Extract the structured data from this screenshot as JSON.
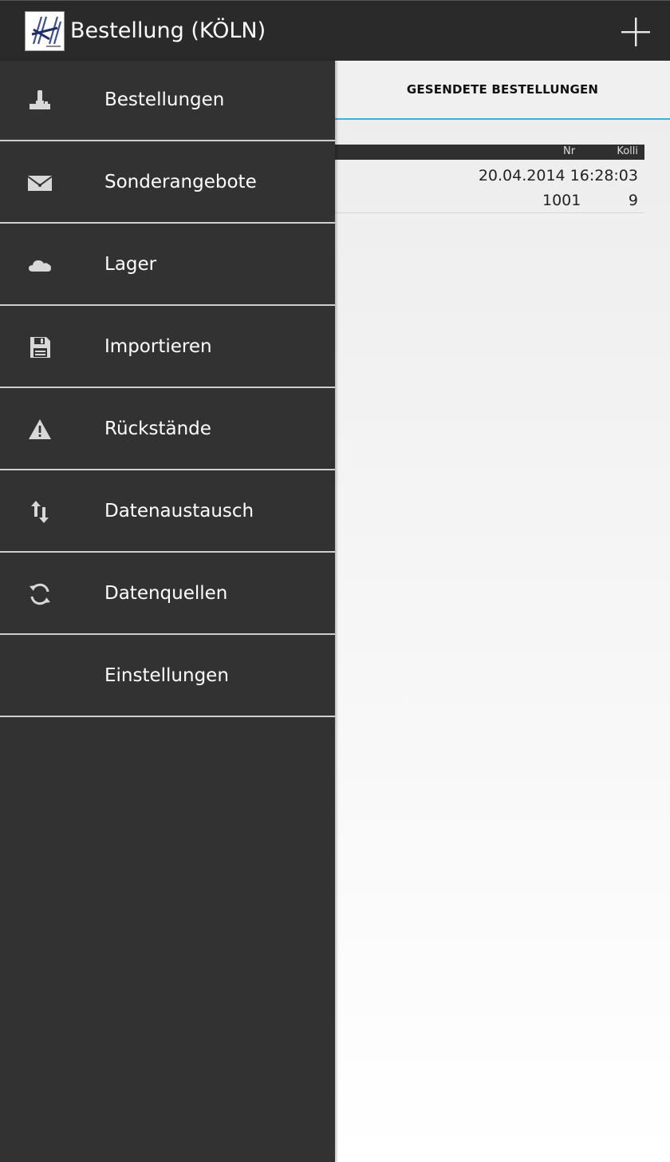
{
  "actionbar": {
    "title": "Bestellung (KÖLN)",
    "logo_icon": "company-logo",
    "add_icon": "plus-icon"
  },
  "tabs": [
    {
      "label": "GESENDETE BESTELLUNGEN",
      "active": true
    }
  ],
  "orders": {
    "columns": {
      "nr": "Nr",
      "kolli": "Kolli"
    },
    "rows": [
      {
        "date": "20.04.2014 16:28:03",
        "nr": "1001",
        "kolli": "9"
      }
    ]
  },
  "drawer": {
    "items": [
      {
        "label": "Bestellungen",
        "icon": "joystick-icon"
      },
      {
        "label": "Sonderangebote",
        "icon": "envelope-icon"
      },
      {
        "label": "Lager",
        "icon": "cloud-icon"
      },
      {
        "label": "Importieren",
        "icon": "floppy-disk-icon"
      },
      {
        "label": "Rückstände",
        "icon": "warning-icon"
      },
      {
        "label": "Datenaustausch",
        "icon": "up-down-arrows-icon"
      },
      {
        "label": "Datenquellen",
        "icon": "sync-icon"
      },
      {
        "label": "Einstellungen",
        "icon": ""
      }
    ]
  },
  "colors": {
    "actionbar": "#2a2a2a",
    "drawer": "#323232",
    "tab_indicator": "#33b5e5",
    "divider": "#cfcfcf"
  }
}
